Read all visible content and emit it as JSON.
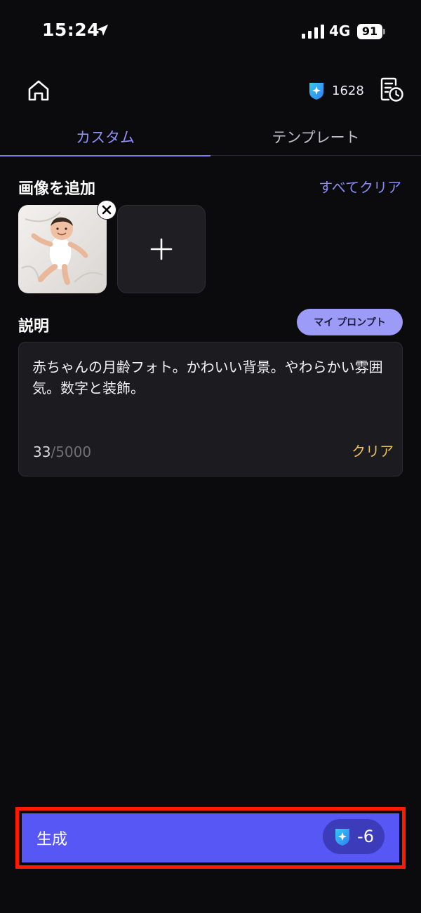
{
  "status_bar": {
    "time": "15:24",
    "network": "4G",
    "battery": "91"
  },
  "header": {
    "credits": "1628"
  },
  "tabs": [
    {
      "label": "カスタム",
      "active": true
    },
    {
      "label": "テンプレート",
      "active": false
    }
  ],
  "add_image": {
    "title": "画像を追加",
    "clear_all": "すべてクリア"
  },
  "description": {
    "title": "説明",
    "my_prompt": "マイ プロンプト",
    "text": "赤ちゃんの月齢フォト。かわいい背景。やわらかい雰囲気。数字と装飾。",
    "count": "33",
    "max": "/5000",
    "clear": "クリア"
  },
  "generate": {
    "label": "生成",
    "cost": "-6"
  },
  "colors": {
    "accent": "#5757f5",
    "tab_active": "#8f8ff5",
    "clear": "#e8c25a",
    "highlight": "#ff1a00"
  }
}
